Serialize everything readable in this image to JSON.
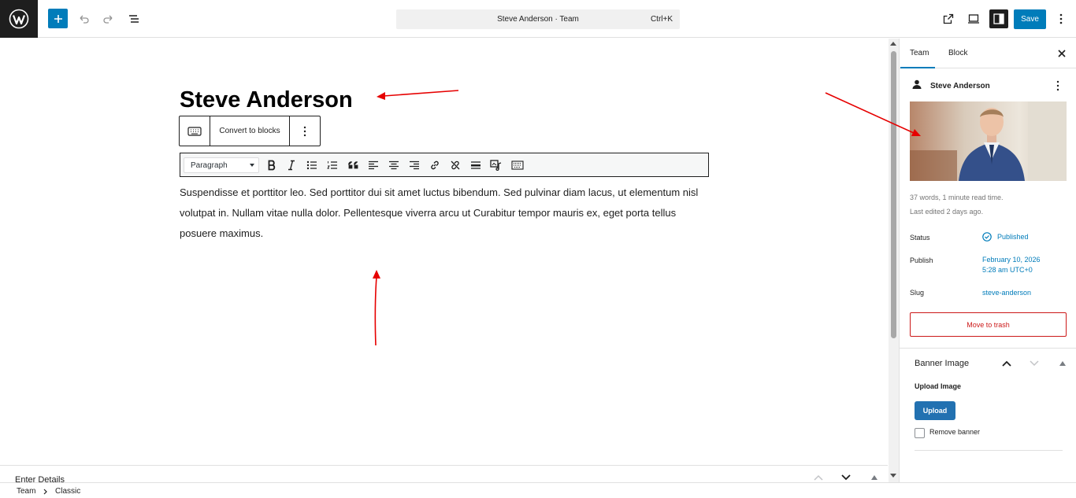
{
  "header": {
    "command_bar_title": "Steve Anderson · Team",
    "command_bar_shortcut": "Ctrl+K",
    "save_label": "Save"
  },
  "editor": {
    "post_title": "Steve Anderson",
    "convert_label": "Convert to blocks",
    "format_select_value": "Paragraph",
    "paragraph": "Suspendisse et porttitor leo. Sed porttitor dui sit amet luctus bibendum. Sed pulvinar diam lacus, ut elementum nisl volutpat in. Nullam vitae nulla dolor. Pellentesque viverra arcu ut Curabitur tempor mauris ex, eget porta tellus posuere maximus."
  },
  "meta_panel": {
    "title": "Enter Details"
  },
  "sidebar": {
    "tabs": [
      "Team",
      "Block"
    ],
    "post_name": "Steve Anderson",
    "word_count": "37 words, 1 minute read time.",
    "last_edited": "Last edited 2 days ago.",
    "status_label": "Status",
    "status_value": "Published",
    "publish_label": "Publish",
    "publish_date": "February 10, 2026",
    "publish_time": "5:28 am UTC+0",
    "slug_label": "Slug",
    "slug_value": "steve-anderson",
    "trash_label": "Move to trash",
    "banner": {
      "title": "Banner Image",
      "upload_label": "Upload Image",
      "upload_button": "Upload",
      "remove_label": "Remove banner"
    }
  },
  "breadcrumb": [
    "Team",
    "Classic"
  ],
  "colors": {
    "accent": "#007cba",
    "danger": "#cc1818",
    "annotation": "#e60000"
  }
}
